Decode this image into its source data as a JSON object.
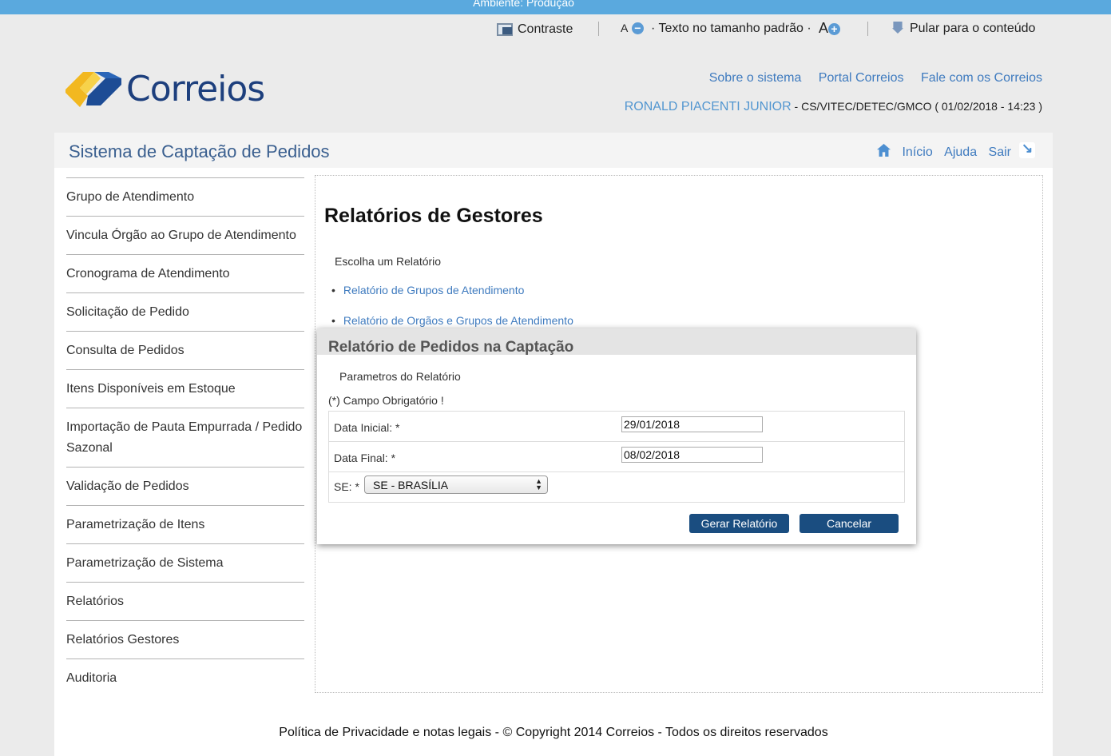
{
  "environment": "Ambiente: Produção",
  "accessibility": {
    "contrast": "Contraste",
    "font_decrease": "A",
    "font_default": "· Texto no tamanho padrão ·",
    "font_increase": "A",
    "skip": "Pular para o conteúdo"
  },
  "logo": {
    "text": "Correios"
  },
  "top_links": [
    "Sobre o sistema",
    "Portal Correios",
    "Fale com os Correios"
  ],
  "user": {
    "name": "RONALD PIACENTI JUNIOR",
    "details": " - CS/VITEC/DETEC/GMCO ( 01/02/2018 - 14:23 )"
  },
  "system_title": "Sistema de Captação de Pedidos",
  "header_links": {
    "home": "Início",
    "help": "Ajuda",
    "exit": "Sair"
  },
  "sidebar": {
    "items": [
      "Grupo de Atendimento",
      "Vincula Órgão ao Grupo de Atendimento",
      "Cronograma de Atendimento",
      "Solicitação de Pedido",
      "Consulta de Pedidos",
      "Itens Disponíveis em Estoque",
      "Importação de Pauta Empurrada / Pedido Sazonal",
      "Validação de Pedidos",
      "Parametrização de Itens",
      "Parametrização de Sistema",
      "Relatórios",
      "Relatórios Gestores",
      "Auditoria"
    ]
  },
  "main": {
    "title": "Relatórios de Gestores",
    "choose_label": "Escolha um Relatório",
    "reports": [
      "Relatório de Grupos de Atendimento",
      "Relatório de Orgãos e Grupos de Atendimento"
    ]
  },
  "modal": {
    "title": "Relatório de Pedidos na Captação",
    "subtitle": "Parametros do Relatório",
    "required_note": "(*) Campo Obrigatório !",
    "start_label": "Data Inicial: *",
    "start_value": "29/01/2018",
    "end_label": "Data Final: *",
    "end_value": "08/02/2018",
    "se_label": "SE: *",
    "se_value": "SE - BRASÍLIA",
    "generate_button": "Gerar Relatório",
    "cancel_button": "Cancelar"
  },
  "footer": "Política de Privacidade e notas legais - © Copyright 2014 Correios - Todos os direitos reservados",
  "colors": {
    "env_bar": "#5aa9de",
    "link": "#3f7bbf",
    "button": "#1a4d80",
    "brand_blue": "#1d3f7d",
    "brand_yellow": "#f2c230"
  }
}
